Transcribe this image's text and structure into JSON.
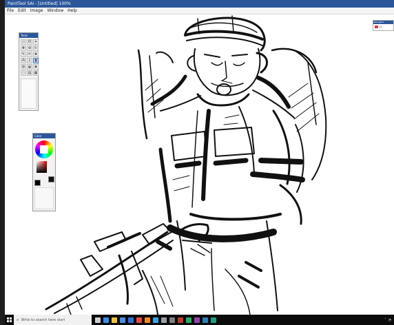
{
  "window": {
    "title": "PaintTool SAI - [Untitled] 100%"
  },
  "menu": {
    "items": [
      "File",
      "Edit",
      "Image",
      "Window",
      "Help"
    ]
  },
  "tool_panel": {
    "title": "Tools",
    "tools": [
      {
        "icon": "select-icon",
        "glyph": "▭",
        "active": false
      },
      {
        "icon": "lasso-icon",
        "glyph": "ʘ",
        "active": false
      },
      {
        "icon": "wand-icon",
        "glyph": "✦",
        "active": false
      },
      {
        "icon": "move-icon",
        "glyph": "✥",
        "active": false
      },
      {
        "icon": "zoom-icon",
        "glyph": "⊕",
        "active": false
      },
      {
        "icon": "rotate-icon",
        "glyph": "↻",
        "active": false
      },
      {
        "icon": "pen-icon",
        "glyph": "✎",
        "active": false
      },
      {
        "icon": "pencil-icon",
        "glyph": "✏",
        "active": false
      },
      {
        "icon": "brush-icon",
        "glyph": "♠",
        "active": false
      },
      {
        "icon": "airbrush-icon",
        "glyph": "⁂",
        "active": false
      },
      {
        "icon": "eraser-icon",
        "glyph": "▯",
        "active": false
      },
      {
        "icon": "marker-icon",
        "glyph": "▮",
        "active": true
      },
      {
        "icon": "water-icon",
        "glyph": "◍",
        "active": false
      },
      {
        "icon": "bucket-icon",
        "glyph": "◒",
        "active": false
      },
      {
        "icon": "binary-icon",
        "glyph": "▪",
        "active": false
      },
      {
        "icon": "blur-icon",
        "glyph": "◌",
        "active": false
      },
      {
        "icon": "text-icon",
        "glyph": "▤",
        "active": false
      },
      {
        "icon": "hand-icon",
        "glyph": "▦",
        "active": false
      }
    ]
  },
  "color_panel": {
    "title": "Color",
    "primary": "#000000",
    "secondary": "#111111"
  },
  "mini_window": {
    "title": "Navigator"
  },
  "taskbar": {
    "search_placeholder": "Write to search here start"
  },
  "colors": {
    "titlebar": "#2b579a",
    "taskbar": "#0b0b0b",
    "ink": "#111111"
  },
  "task_icons": [
    {
      "name": "task-view-icon",
      "color": "#d0d0d0"
    },
    {
      "name": "edge-icon",
      "color": "#3a8ee6"
    },
    {
      "name": "explorer-icon",
      "color": "#f3c23c"
    },
    {
      "name": "store-icon",
      "color": "#4a90e2"
    },
    {
      "name": "mail-icon",
      "color": "#2f6fd6"
    },
    {
      "name": "chrome-icon",
      "color": "#e94b3c"
    },
    {
      "name": "firefox-icon",
      "color": "#f08a24"
    },
    {
      "name": "photos-icon",
      "color": "#3aa3e3"
    },
    {
      "name": "settings-icon",
      "color": "#9aa0a6"
    },
    {
      "name": "camera-icon",
      "color": "#7f7f7f"
    },
    {
      "name": "app-icon-1",
      "color": "#c0392b"
    },
    {
      "name": "app-icon-2",
      "color": "#27ae60"
    },
    {
      "name": "app-icon-3",
      "color": "#8e44ad"
    },
    {
      "name": "app-icon-4",
      "color": "#2980b9"
    },
    {
      "name": "app-icon-5",
      "color": "#16a085"
    }
  ]
}
